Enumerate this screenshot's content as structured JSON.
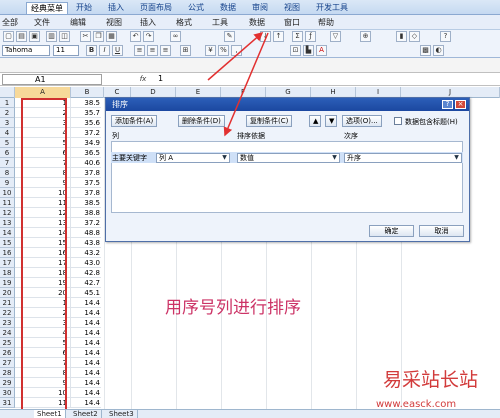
{
  "ribbon": {
    "tabs": [
      "经典菜单",
      "开始",
      "插入",
      "页面布局",
      "公式",
      "数据",
      "审阅",
      "视图",
      "开发工具"
    ],
    "menus": [
      "全部",
      "文件",
      "编辑",
      "视图",
      "插入",
      "格式",
      "工具",
      "数据",
      "窗口",
      "帮助"
    ],
    "font_name": "Tahoma",
    "font_size": "11",
    "bold": "B",
    "italic": "I",
    "underline": "U"
  },
  "formula_bar": {
    "cell_ref": "A1",
    "fx": "fx",
    "value": "1"
  },
  "columns": [
    "A",
    "B",
    "C",
    "D",
    "E",
    "F",
    "G",
    "H",
    "I",
    "J"
  ],
  "rows": [
    {
      "n": "1",
      "a": "1",
      "b": "38.5"
    },
    {
      "n": "2",
      "a": "2",
      "b": "35.7"
    },
    {
      "n": "3",
      "a": "3",
      "b": "35.6"
    },
    {
      "n": "4",
      "a": "4",
      "b": "37.2"
    },
    {
      "n": "5",
      "a": "5",
      "b": "34.9"
    },
    {
      "n": "6",
      "a": "6",
      "b": "36.5"
    },
    {
      "n": "7",
      "a": "7",
      "b": "40.6"
    },
    {
      "n": "8",
      "a": "8",
      "b": "37.8"
    },
    {
      "n": "9",
      "a": "9",
      "b": "37.5"
    },
    {
      "n": "10",
      "a": "10",
      "b": "37.8"
    },
    {
      "n": "11",
      "a": "11",
      "b": "38.5"
    },
    {
      "n": "12",
      "a": "12",
      "b": "38.8"
    },
    {
      "n": "13",
      "a": "13",
      "b": "37.2"
    },
    {
      "n": "14",
      "a": "14",
      "b": "48.8"
    },
    {
      "n": "15",
      "a": "15",
      "b": "43.8"
    },
    {
      "n": "16",
      "a": "16",
      "b": "43.2"
    },
    {
      "n": "17",
      "a": "17",
      "b": "43.0"
    },
    {
      "n": "18",
      "a": "18",
      "b": "42.8"
    },
    {
      "n": "19",
      "a": "19",
      "b": "42.7"
    },
    {
      "n": "20",
      "a": "20",
      "b": "45.1"
    },
    {
      "n": "21",
      "a": "1",
      "b": "14.4"
    },
    {
      "n": "22",
      "a": "2",
      "b": "14.4"
    },
    {
      "n": "23",
      "a": "3",
      "b": "14.4"
    },
    {
      "n": "24",
      "a": "4",
      "b": "14.4"
    },
    {
      "n": "25",
      "a": "5",
      "b": "14.4"
    },
    {
      "n": "26",
      "a": "6",
      "b": "14.4"
    },
    {
      "n": "27",
      "a": "7",
      "b": "14.4"
    },
    {
      "n": "28",
      "a": "8",
      "b": "14.4"
    },
    {
      "n": "29",
      "a": "9",
      "b": "14.4"
    },
    {
      "n": "30",
      "a": "10",
      "b": "14.4"
    },
    {
      "n": "31",
      "a": "11",
      "b": "14.4"
    }
  ],
  "sheets": [
    "Sheet1",
    "Sheet2",
    "Sheet3"
  ],
  "dialog": {
    "title": "排序",
    "help": "?",
    "close": "×",
    "add_level": "添加条件(A)",
    "delete_level": "删除条件(D)",
    "copy_level": "复制条件(C)",
    "up": "▲",
    "down": "▼",
    "options": "选项(O)...",
    "has_headers": "数据包含标题(H)",
    "col_header": "列",
    "sort_on_header": "排序依据",
    "order_header": "次序",
    "row_label": "主要关键字",
    "column_value": "列 A",
    "sort_on_value": "数值",
    "order_value": "升序",
    "ok": "确定",
    "cancel": "取消"
  },
  "annotation": "用序号列进行排序",
  "watermark": {
    "text": "易采站长站",
    "url": "www.easck.com"
  },
  "colors": {
    "annotation": "#cc3366",
    "selection_border": "#d03030",
    "arrow": "#e23030"
  }
}
